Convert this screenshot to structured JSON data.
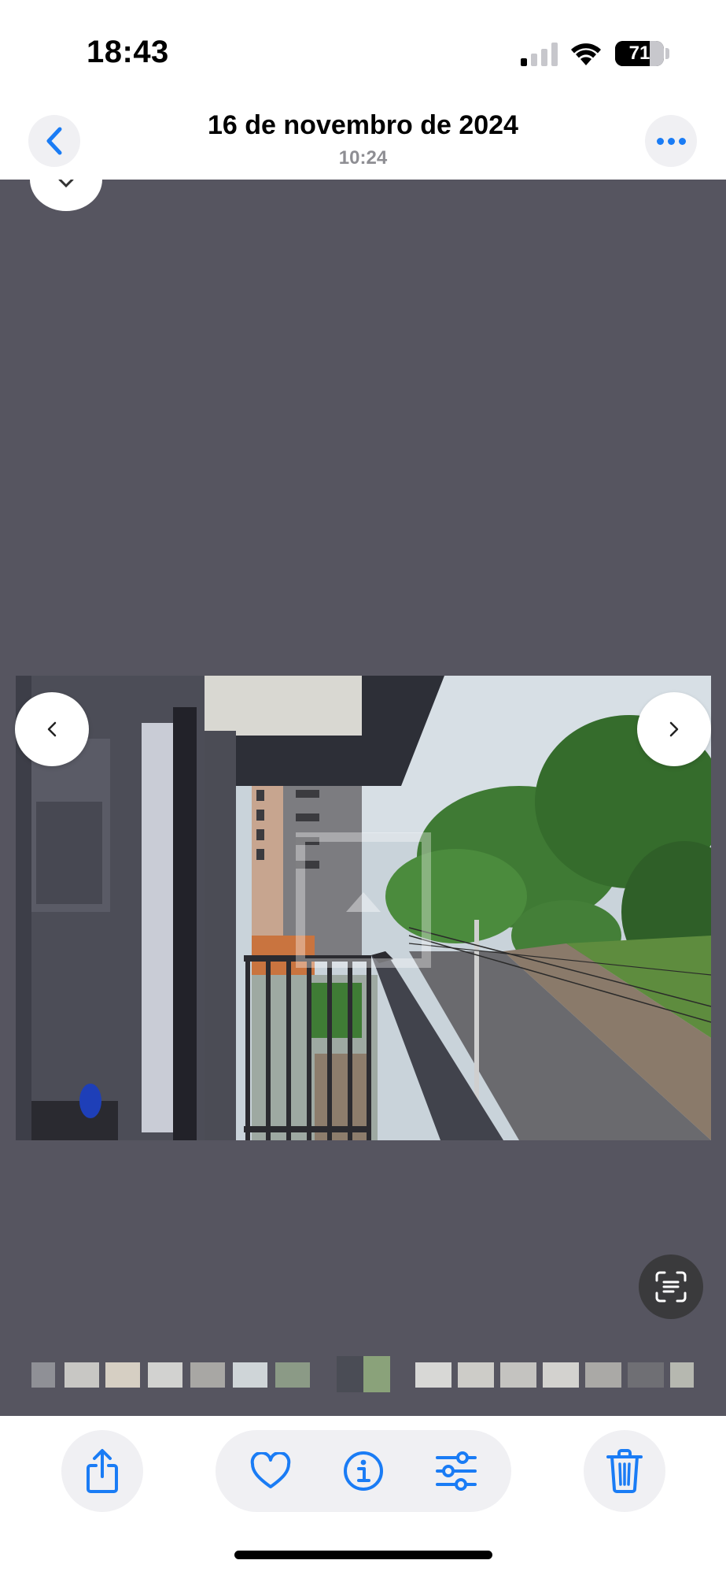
{
  "status_bar": {
    "time": "18:43",
    "battery_percent": "71",
    "battery_level": 0.71,
    "signal_bars_active": 1,
    "signal_bars_total": 4,
    "icons": [
      "cellular-signal-icon",
      "wifi-icon",
      "battery-icon"
    ]
  },
  "header": {
    "title": "16 de novembro de 2024",
    "subtitle": "10:24",
    "back_icon": "chevron-left-icon",
    "more_icon": "ellipsis-icon"
  },
  "viewer": {
    "background_color": "#565560",
    "photo_description_icon": "photo",
    "prev_icon": "chevron-left-icon",
    "next_icon": "chevron-right-icon",
    "close_icon": "close-icon",
    "live_text_icon": "live-text-scan-icon"
  },
  "filmstrip": {
    "thumbnail_count": 15,
    "active_index": 7
  },
  "toolbar": {
    "share_icon": "share-icon",
    "favorite_icon": "heart-icon",
    "info_icon": "info-icon",
    "adjust_icon": "adjust-sliders-icon",
    "delete_icon": "trash-icon"
  },
  "colors": {
    "accent": "#1a7cf5",
    "viewer_bg": "#565560",
    "button_bg": "#f0f0f3"
  }
}
